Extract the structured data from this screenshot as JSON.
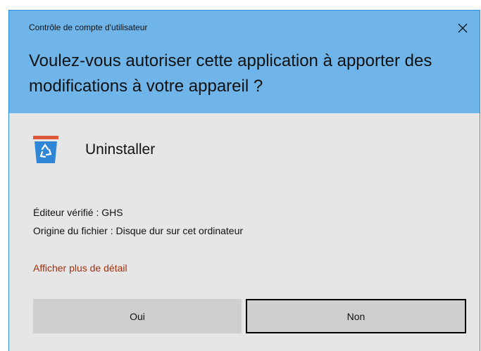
{
  "dialog": {
    "caption": "Contrôle de compte d'utilisateur",
    "question": "Voulez-vous autoriser cette application à apporter des modifications à votre appareil ?"
  },
  "app": {
    "name": "Uninstaller",
    "icon": "recycle-bin-icon"
  },
  "info": {
    "publisher": "Éditeur vérifié : GHS",
    "origin": "Origine du fichier : Disque dur sur cet ordinateur"
  },
  "details_link": "Afficher plus de détail",
  "buttons": {
    "yes": "Oui",
    "no": "Non"
  },
  "colors": {
    "header": "#70b5ea",
    "body": "#e6e6e6",
    "link": "#a3300f",
    "button": "#cfcfcf",
    "icon_bin": "#2f86d6",
    "icon_lid": "#e05a3a"
  }
}
